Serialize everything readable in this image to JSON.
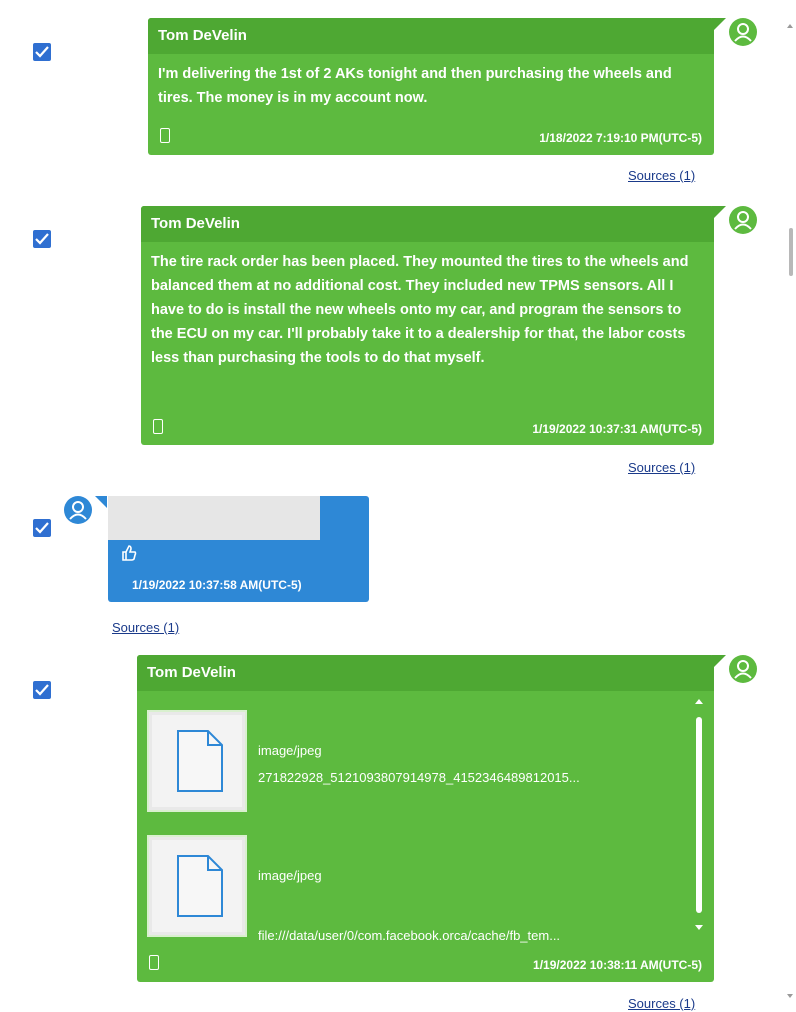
{
  "messages": [
    {
      "sender": "Tom DeVelin",
      "text": "I'm delivering the 1st of 2 AKs tonight and then purchasing the wheels and tires.  The money is in my account now.",
      "timestamp": "1/18/2022 7:19:10 PM(UTC-5)",
      "sources": "Sources (1)"
    },
    {
      "sender": "Tom DeVelin",
      "text": "The tire rack order has been placed.  They mounted the tires to the wheels and balanced them at no additional cost.  They included new TPMS sensors.  All I have to do is install the new wheels onto my car, and program the sensors to the ECU on my car.  I'll probably take it to a dealership for that, the labor costs less than purchasing the tools to do that myself.",
      "timestamp": "1/19/2022 10:37:31 AM(UTC-5)",
      "sources": "Sources (1)"
    },
    {
      "sender": "",
      "reaction_icon": "thumbs-up-icon",
      "timestamp": "1/19/2022 10:37:58 AM(UTC-5)",
      "sources": "Sources (1)"
    },
    {
      "sender": "Tom DeVelin",
      "attachments": [
        {
          "type": "image/jpeg",
          "name": "271822928_5121093807914978_4152346489812015..."
        },
        {
          "type": "image/jpeg",
          "name": "file:///data/user/0/com.facebook.orca/cache/fb_tem..."
        }
      ],
      "timestamp": "1/19/2022 10:38:11 AM(UTC-5)",
      "sources": "Sources (1)"
    }
  ],
  "colors": {
    "outgoing_bubble": "#5dba3f",
    "outgoing_header": "#4ea833",
    "incoming_bubble": "#2e88d6",
    "checkbox": "#2f6fd1",
    "link": "#1a3a8a"
  }
}
